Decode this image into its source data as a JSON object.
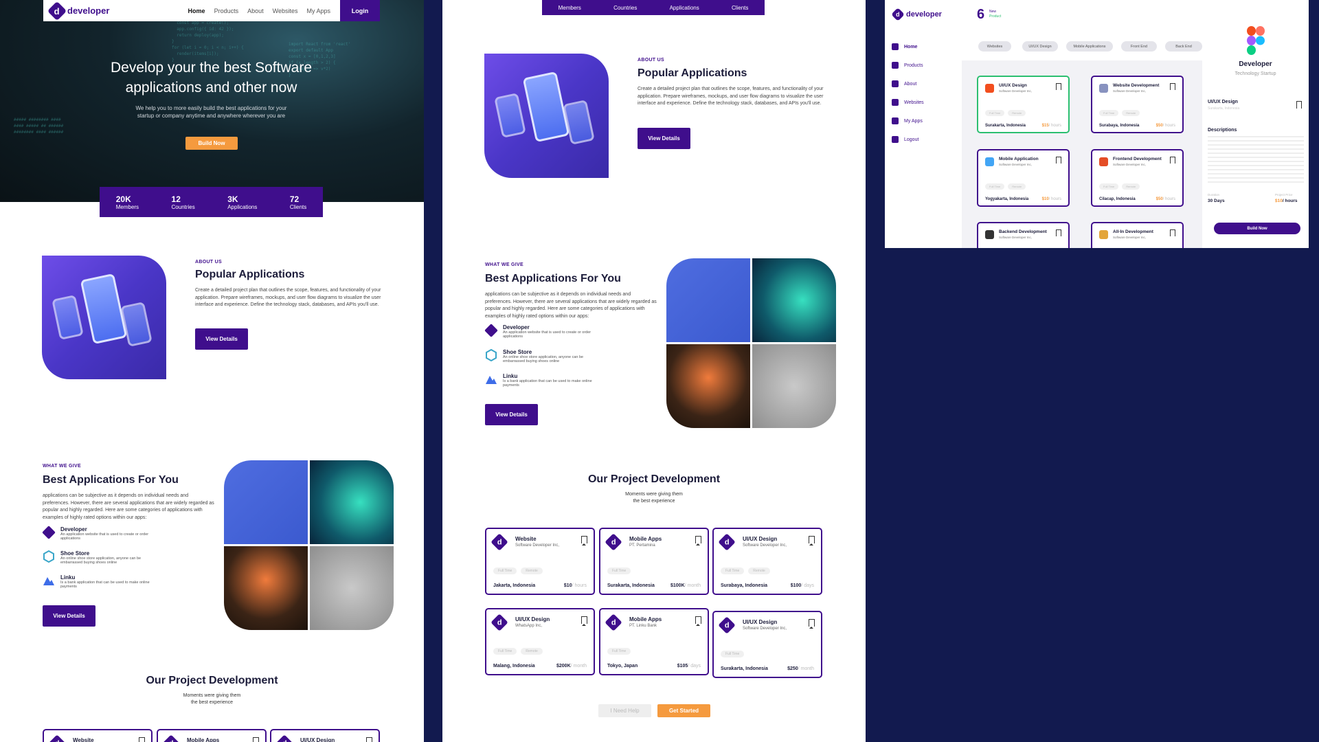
{
  "nav": {
    "brand": "developer",
    "links": [
      "Home",
      "Products",
      "About",
      "Websites",
      "My Apps"
    ],
    "login": "Login"
  },
  "hero": {
    "title": "Develop your the best Software applications and other now",
    "subtitle": "We help you to more easily build the best applications for your startup or company anytime and anywhere wherever you are",
    "cta": "Build Now"
  },
  "stats": [
    {
      "value": "20K",
      "label": "Members"
    },
    {
      "value": "12",
      "label": "Countries"
    },
    {
      "value": "3K",
      "label": "Applications"
    },
    {
      "value": "72",
      "label": "Clients"
    }
  ],
  "about": {
    "label": "ABOUT US",
    "title": "Popular Applications",
    "text": "Create a detailed project plan that outlines the scope, features, and functionality of your application. Prepare wireframes, mockups, and user flow diagrams to visualize the user interface and experience. Define the technology stack, databases, and APIs you'll use.",
    "button": "View Details"
  },
  "give": {
    "label": "WHAT WE GIVE",
    "title": "Best Applications For You",
    "text": "applications can be subjective as it depends on individual needs and preferences. However, there are several applications that are widely regarded as popular and highly regarded. Here are some categories of applications with examples of highly rated options within our apps:",
    "features": [
      {
        "title": "Developer",
        "desc": "An application website that is used to create or order applications",
        "icon": "developer-logo-icon",
        "color": "#3f0e8c"
      },
      {
        "title": "Shoe Store",
        "desc": "An online shoe store application, anyone can be embarrassed buying shoes online",
        "icon": "hexagon-icon",
        "color": "#3aa6c9"
      },
      {
        "title": "Linku",
        "desc": "Is a bank application that can be used to make online payments",
        "icon": "mountain-icon",
        "color": "#3e6de8"
      }
    ],
    "button": "View Details"
  },
  "projects": {
    "title": "Our Project Development",
    "subtitle_line1": "Moments were giving them",
    "subtitle_line2": "the best experience",
    "cards": [
      {
        "title": "Website",
        "company": "Software Developer Inc,",
        "tags": [
          "Full Time",
          "Remote"
        ],
        "location": "Jakarta, Indonesia",
        "price": "$10",
        "unit": "/ hours"
      },
      {
        "title": "Mobile Apps",
        "company": "PT. Pertamina",
        "tags": [
          "Full Time"
        ],
        "location": "Surakarta, Indonesia",
        "price": "$100K",
        "unit": "/ month"
      },
      {
        "title": "UI/UX Design",
        "company": "Software Developer Inc,",
        "tags": [
          "Full Time",
          "Remote"
        ],
        "location": "Surabaya, Indonesia",
        "price": "$100",
        "unit": "/ days"
      },
      {
        "title": "UI/UX Design",
        "company": "WhatsApp Inc,",
        "tags": [
          "Full Time",
          "Remote"
        ],
        "location": "Malang, Indonesia",
        "price": "$200K",
        "unit": "/ month"
      },
      {
        "title": "Mobile Apps",
        "company": "PT. Linku Bank",
        "tags": [
          "Full Time"
        ],
        "location": "Tokyo, Japan",
        "price": "$105",
        "unit": "/ days"
      },
      {
        "title": "UI/UX Design",
        "company": "Software Developer Inc,",
        "tags": [
          "Full Time"
        ],
        "location": "Surakarta, Indonesia",
        "price": "$250",
        "unit": "/ month"
      }
    ],
    "help_button": "I Need Help",
    "start_button": "Get Started"
  },
  "panel2_nav": [
    "Members",
    "Countries",
    "Applications",
    "Clients"
  ],
  "dashboard": {
    "brand": "developer",
    "menu": [
      "Home",
      "Products",
      "About",
      "Websites",
      "My Apps",
      "Logout"
    ],
    "count": "6",
    "count_label_1": "New",
    "count_label_2": "Product",
    "filters": [
      "Websites",
      "UI/UX Design",
      "Mobile Applications",
      "Front End",
      "Back End"
    ],
    "cards": [
      {
        "title": "UI/UX Design",
        "company": "Software Developer Inc,",
        "tags": [
          "Full Time",
          "Remote"
        ],
        "location": "Surakarta, Indonesia",
        "price": "$15",
        "unit": "/ hours",
        "icon": "figma-icon"
      },
      {
        "title": "Website Development",
        "company": "Software Developer Inc,",
        "tags": [
          "Full Time",
          "Remote"
        ],
        "location": "Surabaya, Indonesia",
        "price": "$50",
        "unit": "/ hours",
        "icon": "php-icon"
      },
      {
        "title": "Mobile Application",
        "company": "Software Developer Inc,",
        "tags": [
          "Full Time",
          "Remote"
        ],
        "location": "Yogyakarta, Indonesia",
        "price": "$10",
        "unit": "/ hours",
        "icon": "flutter-icon"
      },
      {
        "title": "Frontend Development",
        "company": "Software Developer Inc,",
        "tags": [
          "Full Time",
          "Remote"
        ],
        "location": "Cilacap, Indonesia",
        "price": "$50",
        "unit": "/ hours",
        "icon": "html5-icon"
      },
      {
        "title": "Backend Development",
        "company": "Software Developer Inc,",
        "tags": [],
        "location": "",
        "price": "",
        "unit": "",
        "icon": "server-icon"
      },
      {
        "title": "All-In Development",
        "company": "Software Developer Inc,",
        "tags": [],
        "location": "",
        "price": "",
        "unit": "",
        "icon": "stack-icon"
      }
    ],
    "detail": {
      "name": "Developer",
      "subtitle": "Technology Startup",
      "job": "UI/UX Design",
      "job_location": "Surakarta, Indonesia",
      "desc_title": "Descriptions",
      "duration_label": "Duration",
      "duration": "30 Days",
      "price_label": "Project Price",
      "price": "$10",
      "price_unit": "/ hours",
      "button": "Build Now"
    }
  }
}
